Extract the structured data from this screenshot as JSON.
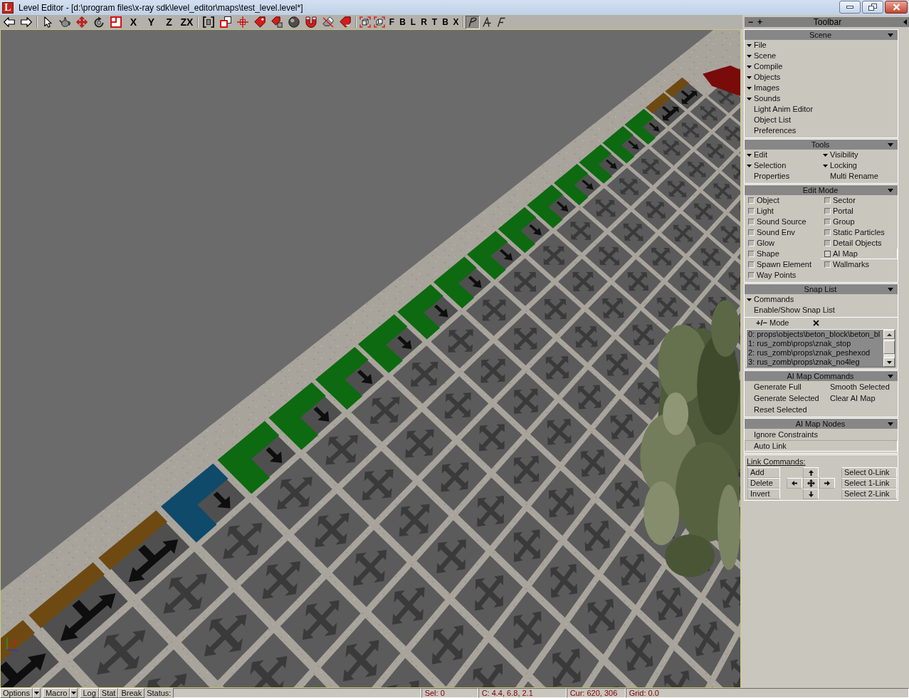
{
  "window": {
    "icon_letter": "L",
    "title": "Level Editor - [d:\\program files\\x-ray sdk\\level_editor\\maps\\test_level.level*]"
  },
  "toolbar": [
    {
      "kind": "icon",
      "pressed": false
    },
    {
      "kind": "icon",
      "pressed": false
    },
    {
      "kind": "separator"
    },
    {
      "kind": "icon",
      "pressed": false
    },
    {
      "kind": "icon",
      "pressed": false
    },
    {
      "kind": "icon",
      "pressed": false
    },
    {
      "kind": "icon",
      "pressed": false
    },
    {
      "kind": "icon",
      "pressed": false
    },
    {
      "kind": "axis",
      "label": "X",
      "pressed": false
    },
    {
      "kind": "axis",
      "label": "Y",
      "pressed": false
    },
    {
      "kind": "axis",
      "label": "Z",
      "pressed": false
    },
    {
      "kind": "axis",
      "label": "ZX",
      "pressed": false
    },
    {
      "kind": "separator"
    },
    {
      "kind": "icon",
      "pressed": false
    },
    {
      "kind": "icon",
      "pressed": false
    },
    {
      "kind": "icon",
      "pressed": false
    },
    {
      "kind": "icon",
      "pressed": false
    },
    {
      "kind": "icon",
      "pressed": false
    },
    {
      "kind": "icon",
      "pressed": false
    },
    {
      "kind": "icon",
      "pressed": false
    },
    {
      "kind": "icon",
      "pressed": false
    },
    {
      "kind": "icon",
      "pressed": false
    },
    {
      "kind": "separator"
    },
    {
      "kind": "small_icon",
      "pressed": false
    },
    {
      "kind": "small_icon",
      "pressed": false
    },
    {
      "kind": "view",
      "label": "F",
      "pressed": false
    },
    {
      "kind": "view",
      "label": "B",
      "pressed": false
    },
    {
      "kind": "view",
      "label": "L",
      "pressed": false
    },
    {
      "kind": "view",
      "label": "R",
      "pressed": false
    },
    {
      "kind": "view",
      "label": "T",
      "pressed": false
    },
    {
      "kind": "view",
      "label": "B",
      "pressed": false
    },
    {
      "kind": "view",
      "label": "X",
      "pressed": false
    },
    {
      "kind": "separator"
    },
    {
      "kind": "small_icon",
      "pressed": true
    },
    {
      "kind": "small_icon",
      "pressed": false
    },
    {
      "kind": "small_icon",
      "pressed": false
    }
  ],
  "panel": {
    "title": "Toolbar",
    "buttons": [
      "−",
      "+"
    ]
  },
  "sections": [
    {
      "kind": "list",
      "title": "Scene",
      "expanded": true,
      "items": [
        {
          "kind": "menu",
          "label": "File"
        },
        {
          "kind": "menu",
          "label": "Scene"
        },
        {
          "kind": "menu",
          "label": "Compile"
        },
        {
          "kind": "menu",
          "label": "Objects"
        },
        {
          "kind": "menu",
          "label": "Images"
        },
        {
          "kind": "menu",
          "label": "Sounds"
        },
        {
          "kind": "command",
          "label": "Light Anim Editor"
        },
        {
          "kind": "command",
          "label": "Object List"
        },
        {
          "kind": "command",
          "label": "Preferences"
        }
      ]
    },
    {
      "kind": "grid",
      "title": "Tools",
      "expanded": true,
      "items": [
        {
          "kind": "menu",
          "label": "Edit"
        },
        {
          "kind": "menu",
          "label": "Visibility"
        },
        {
          "kind": "menu",
          "label": "Selection"
        },
        {
          "kind": "menu",
          "label": "Locking"
        },
        {
          "kind": "command",
          "label": "Properties"
        },
        {
          "kind": "command",
          "label": "Multi Rename"
        }
      ]
    },
    {
      "kind": "checks",
      "title": "Edit Mode",
      "expanded": true,
      "items": [
        {
          "label": "Object",
          "checked": false,
          "selected": false
        },
        {
          "label": "Sector",
          "checked": false,
          "selected": false
        },
        {
          "label": "Light",
          "checked": false,
          "selected": false
        },
        {
          "label": "Portal",
          "checked": false,
          "selected": false
        },
        {
          "label": "Sound Source",
          "checked": false,
          "selected": false
        },
        {
          "label": "Group",
          "checked": false,
          "selected": false
        },
        {
          "label": "Sound Env",
          "checked": false,
          "selected": false
        },
        {
          "label": "Static Particles",
          "checked": false,
          "selected": false
        },
        {
          "label": "Glow",
          "checked": false,
          "selected": false
        },
        {
          "label": "Detail Objects",
          "checked": false,
          "selected": false
        },
        {
          "label": "Shape",
          "checked": false,
          "selected": false
        },
        {
          "label": "AI Map",
          "checked": false,
          "selected": true
        },
        {
          "label": "Spawn Element",
          "checked": false,
          "selected": false
        },
        {
          "label": "Wallmarks",
          "checked": false,
          "selected": false
        },
        {
          "label": "Way Points",
          "checked": false,
          "selected": false
        }
      ]
    },
    {
      "kind": "snap",
      "title": "Snap List",
      "expanded": true,
      "items": [
        {
          "kind": "menu",
          "label": "Commands"
        },
        {
          "kind": "command",
          "label": "Enable/Show Snap List"
        }
      ],
      "mode_label": "**+/−** Mode",
      "list": [
        "0: props\\objects\\beton_block\\beton_bl",
        "1: rus_zomb\\props\\znak_stop",
        "2: rus_zomb\\props\\znak_peshexod",
        "3: rus_zomb\\props\\znak_no4leg"
      ]
    },
    {
      "kind": "buttons",
      "title": "AI Map Commands",
      "expanded": true,
      "items": [
        "Generate Full",
        "Smooth Selected",
        "Generate Selected",
        "Clear AI Map",
        "Reset Selected"
      ]
    },
    {
      "kind": "toggles",
      "title": "AI Map Nodes",
      "expanded": true,
      "items": [
        {
          "label": "Ignore Constraints",
          "pressed": false
        },
        {
          "label": "Auto Link",
          "pressed": true
        }
      ]
    }
  ],
  "link_commands": {
    "title": "Link Commands:",
    "actions": [
      "Add",
      "Delete",
      "Invert"
    ],
    "selects": [
      "Select 0-Link",
      "Select 1-Link",
      "Select 2-Link"
    ]
  },
  "status_bar": {
    "buttons": [
      {
        "kind": "menu",
        "label": "Options"
      },
      {
        "kind": "menu",
        "label": "Macro"
      },
      {
        "kind": "button",
        "label": "Log"
      },
      {
        "kind": "button",
        "label": "Stat"
      },
      {
        "kind": "button",
        "label": "Break"
      }
    ],
    "status_label": "Status:",
    "readouts": [
      "Sel: 0",
      "C: 4.4, 6.8, 2.1",
      "Cur: 620, 306",
      "Grid: 0.0"
    ]
  }
}
